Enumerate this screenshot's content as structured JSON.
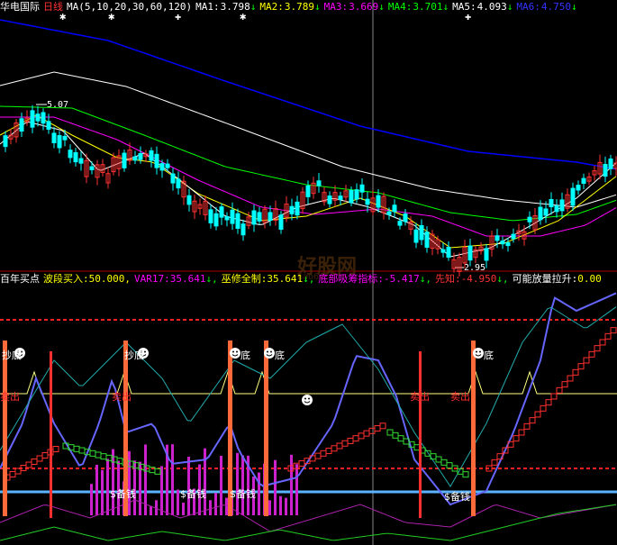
{
  "top_header": {
    "name": "华电国际",
    "period": "日线",
    "ma_params": "MA(5,10,20,30,60,120)",
    "items": [
      {
        "label": "MA1:",
        "value": "3.798",
        "arrow": "↓",
        "color": "#ffffff"
      },
      {
        "label": "MA2:",
        "value": "3.789",
        "arrow": "↓",
        "color": "#ffff00"
      },
      {
        "label": "MA3:",
        "value": "3.669",
        "arrow": "↓",
        "color": "#ff00ff"
      },
      {
        "label": "MA4:",
        "value": "3.701",
        "arrow": "↓",
        "color": "#00ff00"
      },
      {
        "label": "MA5:",
        "value": "4.093",
        "arrow": "↓",
        "color": "#ffffff"
      },
      {
        "label": "MA6:",
        "value": "4.750",
        "arrow": "↓",
        "color": "#0000ff"
      }
    ]
  },
  "price_chart": {
    "high_label": "5.07",
    "low_label": "2.95"
  },
  "bottom_header": {
    "title": "百年买点",
    "items": [
      {
        "label": "波段买入:",
        "value": "50.000,",
        "color": "#ffff00"
      },
      {
        "label": "VAR17:",
        "value": "35.641",
        "arrow": "↓,",
        "color": "#ff00ff"
      },
      {
        "label": "巫修全制:",
        "value": "35.641",
        "arrow": "↓,",
        "color": "#ffff00"
      },
      {
        "label": "底部吸筹指标:",
        "value": "-5.417",
        "arrow": "↓,",
        "color": "#ff00ff"
      },
      {
        "label": "先知:",
        "value": "-4.950",
        "arrow": "↓,",
        "color": "#ff3333"
      },
      {
        "label": "可能放量拉升:",
        "value": "0.00",
        "arrow": "",
        "color": "#ffffff"
      }
    ]
  },
  "indicator_labels": {
    "chaodi": "抄底",
    "di": "底",
    "maichu": "卖出",
    "beiqian": "$备钱"
  },
  "watermark": {
    "text": "好股网",
    "url": "hao6v.com"
  },
  "colors": {
    "up": "#ff3232",
    "down": "#00ffff",
    "ma1": "#ffffff",
    "ma2": "#ffff00",
    "ma3": "#ff00ff",
    "ma4": "#00ff00",
    "ma5": "#ffffff",
    "ma6": "#0000ff",
    "signal": "#ff6a3a",
    "blueline": "#6666ff"
  }
}
